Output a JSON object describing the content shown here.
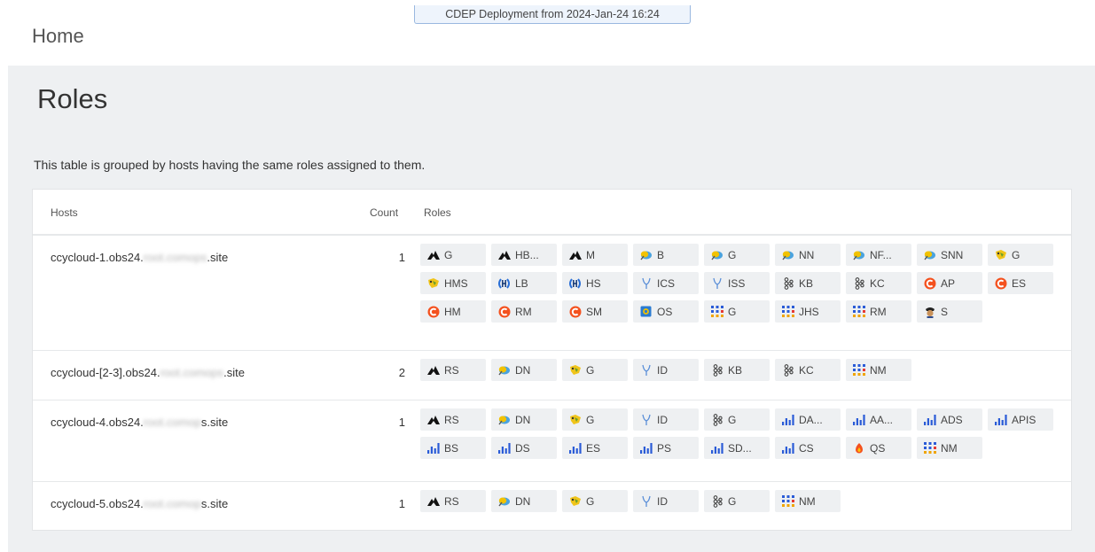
{
  "banner": {
    "text": "CDEP Deployment from 2024-Jan-24 16:24"
  },
  "header": {
    "title": "Home"
  },
  "page": {
    "title": "Roles",
    "description": "This table is grouped by hosts having the same roles assigned to them."
  },
  "table": {
    "columns": {
      "hosts": "Hosts",
      "count": "Count",
      "roles": "Roles"
    },
    "rows": [
      {
        "host_prefix": "ccycloud-1.obs24.",
        "host_redacted": "root.comops",
        "host_suffix": ".site",
        "count": "1",
        "roles": [
          {
            "icon": "hbase-icon",
            "label": "G"
          },
          {
            "icon": "hbase-icon",
            "label": "HB..."
          },
          {
            "icon": "hbase-icon",
            "label": "M"
          },
          {
            "icon": "hdfs-icon",
            "label": "B"
          },
          {
            "icon": "hdfs-icon",
            "label": "G"
          },
          {
            "icon": "hdfs-icon",
            "label": "NN"
          },
          {
            "icon": "hdfs-icon",
            "label": "NF..."
          },
          {
            "icon": "hdfs-icon",
            "label": "SNN"
          },
          {
            "icon": "hive-icon",
            "label": "G"
          },
          {
            "icon": "hive-icon",
            "label": "HMS"
          },
          {
            "icon": "hue-icon",
            "label": "LB"
          },
          {
            "icon": "hue-icon",
            "label": "HS"
          },
          {
            "icon": "impala-icon",
            "label": "ICS"
          },
          {
            "icon": "impala-icon",
            "label": "ISS"
          },
          {
            "icon": "kafka-icon",
            "label": "KB"
          },
          {
            "icon": "kafka-icon",
            "label": "KC"
          },
          {
            "icon": "cloudera-icon",
            "label": "AP"
          },
          {
            "icon": "cloudera-icon",
            "label": "ES"
          },
          {
            "icon": "cloudera-icon",
            "label": "HM"
          },
          {
            "icon": "cloudera-icon",
            "label": "RM"
          },
          {
            "icon": "cloudera-icon",
            "label": "SM"
          },
          {
            "icon": "oozie-icon",
            "label": "OS"
          },
          {
            "icon": "yarn-icon",
            "label": "G"
          },
          {
            "icon": "yarn-icon",
            "label": "JHS"
          },
          {
            "icon": "yarn-icon",
            "label": "RM"
          },
          {
            "icon": "zookeeper-icon",
            "label": "S"
          }
        ]
      },
      {
        "host_prefix": "ccycloud-[2-3].obs24.",
        "host_redacted": "root.comops",
        "host_suffix": ".site",
        "count": "2",
        "roles": [
          {
            "icon": "hbase-icon",
            "label": "RS"
          },
          {
            "icon": "hdfs-icon",
            "label": "DN"
          },
          {
            "icon": "hive-icon",
            "label": "G"
          },
          {
            "icon": "impala-icon",
            "label": "ID"
          },
          {
            "icon": "kafka-icon",
            "label": "KB"
          },
          {
            "icon": "kafka-icon",
            "label": "KC"
          },
          {
            "icon": "yarn-icon",
            "label": "NM"
          }
        ]
      },
      {
        "host_prefix": "ccycloud-4.obs24.",
        "host_redacted": "root.comop",
        "host_suffix": "s.site",
        "count": "1",
        "roles": [
          {
            "icon": "hbase-icon",
            "label": "RS"
          },
          {
            "icon": "hdfs-icon",
            "label": "DN"
          },
          {
            "icon": "hive-icon",
            "label": "G"
          },
          {
            "icon": "impala-icon",
            "label": "ID"
          },
          {
            "icon": "kafka-icon",
            "label": "G"
          },
          {
            "icon": "bars-icon",
            "label": "DA..."
          },
          {
            "icon": "bars-icon",
            "label": "AA..."
          },
          {
            "icon": "bars-icon",
            "label": "ADS"
          },
          {
            "icon": "bars-icon",
            "label": "APIS"
          },
          {
            "icon": "bars-icon",
            "label": "BS"
          },
          {
            "icon": "bars-icon",
            "label": "DS"
          },
          {
            "icon": "bars-icon",
            "label": "ES"
          },
          {
            "icon": "bars-icon",
            "label": "PS"
          },
          {
            "icon": "bars-icon",
            "label": "SD..."
          },
          {
            "icon": "bars-icon",
            "label": "CS"
          },
          {
            "icon": "queue-icon",
            "label": "QS"
          },
          {
            "icon": "yarn-icon",
            "label": "NM"
          }
        ]
      },
      {
        "host_prefix": "ccycloud-5.obs24.",
        "host_redacted": "root.comop",
        "host_suffix": "s.site",
        "count": "1",
        "roles": [
          {
            "icon": "hbase-icon",
            "label": "RS"
          },
          {
            "icon": "hdfs-icon",
            "label": "DN"
          },
          {
            "icon": "hive-icon",
            "label": "G"
          },
          {
            "icon": "impala-icon",
            "label": "ID"
          },
          {
            "icon": "kafka-icon",
            "label": "G"
          },
          {
            "icon": "yarn-icon",
            "label": "NM"
          }
        ]
      }
    ]
  }
}
